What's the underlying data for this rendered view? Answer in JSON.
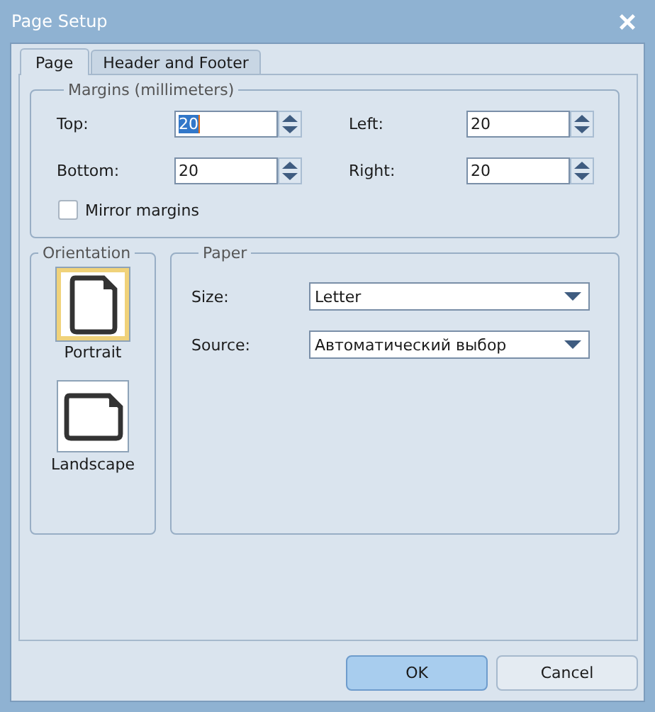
{
  "window": {
    "title": "Page Setup"
  },
  "tabs": [
    {
      "label": "Page",
      "selected": true
    },
    {
      "label": "Header and Footer",
      "selected": false
    }
  ],
  "margins": {
    "title": "Margins (millimeters)",
    "fields": [
      {
        "label": "Top:",
        "value": "20",
        "focused": true
      },
      {
        "label": "Left:",
        "value": "20",
        "focused": false
      },
      {
        "label": "Bottom:",
        "value": "20",
        "focused": false
      },
      {
        "label": "Right:",
        "value": "20",
        "focused": false
      }
    ],
    "mirror": {
      "label": "Mirror margins",
      "checked": false
    }
  },
  "orientation": {
    "title": "Orientation",
    "options": [
      {
        "label": "Portrait",
        "selected": true
      },
      {
        "label": "Landscape",
        "selected": false
      }
    ]
  },
  "paper": {
    "title": "Paper",
    "fields": [
      {
        "label": "Size:",
        "value": "Letter"
      },
      {
        "label": "Source:",
        "value": "Автоматический выбор"
      }
    ]
  },
  "buttons": [
    {
      "label": "OK",
      "default": true
    },
    {
      "label": "Cancel",
      "default": false
    }
  ]
}
